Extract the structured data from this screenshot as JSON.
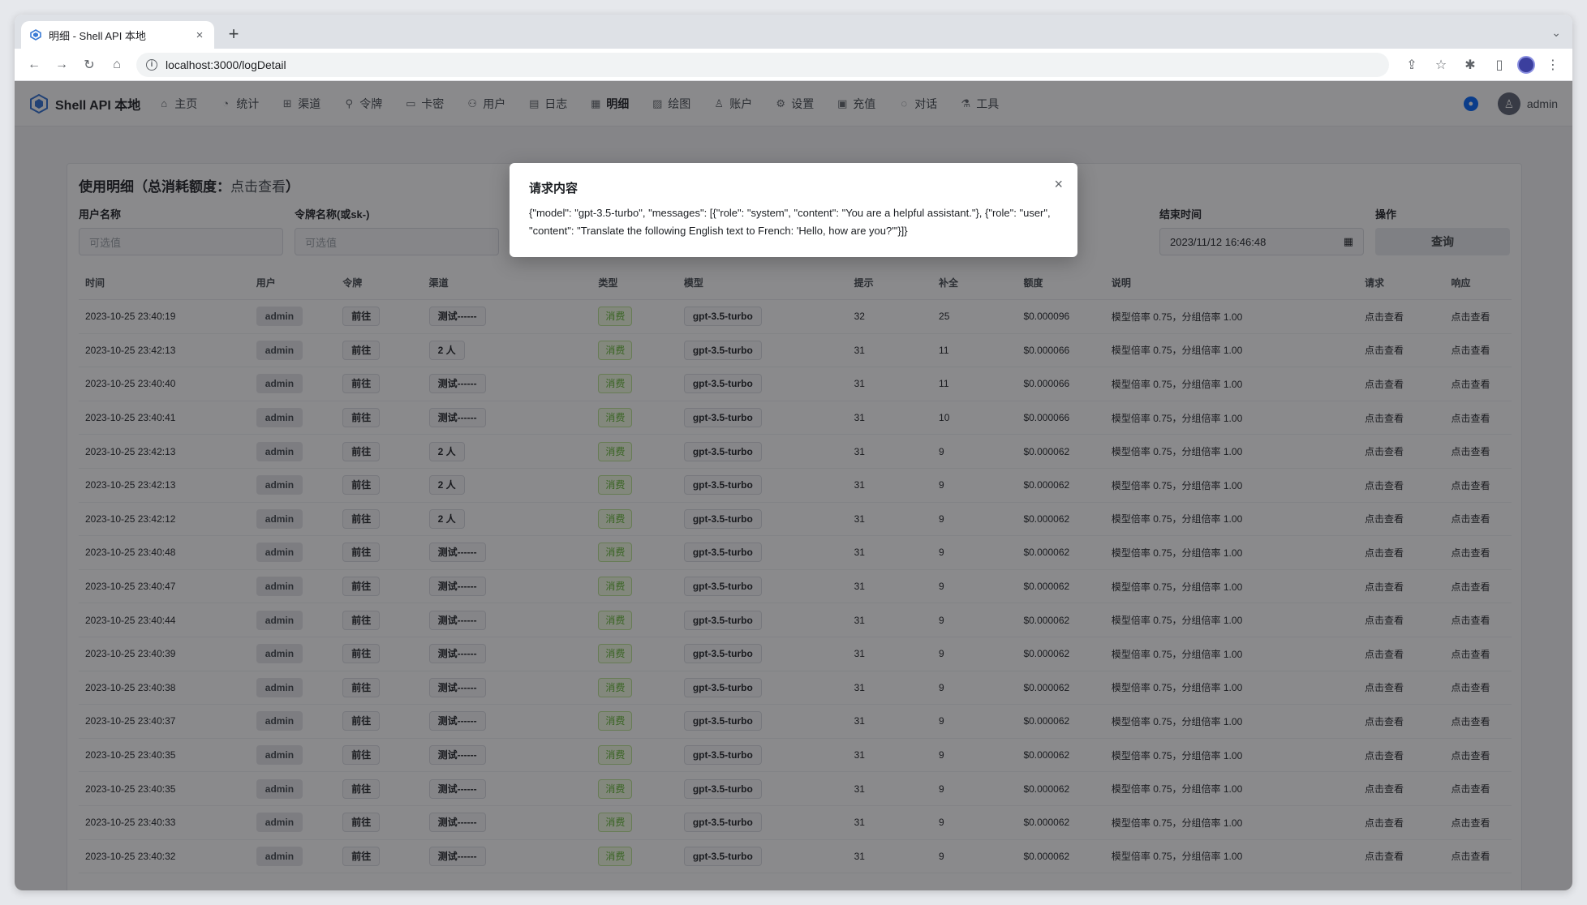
{
  "browser": {
    "tab_title": "明细 - Shell API 本地",
    "tab_close": "×",
    "new_tab": "+",
    "url": "localhost:3000/logDetail"
  },
  "navbar": {
    "brand": "Shell API 本地",
    "items": [
      {
        "label": "主页",
        "icon": "home-icon",
        "glyph": "⌂"
      },
      {
        "label": "统计",
        "icon": "chart-icon",
        "glyph": "◔"
      },
      {
        "label": "渠道",
        "icon": "channel-icon",
        "glyph": "⊞"
      },
      {
        "label": "令牌",
        "icon": "key-icon",
        "glyph": "⚲"
      },
      {
        "label": "卡密",
        "icon": "card-icon",
        "glyph": "▭"
      },
      {
        "label": "用户",
        "icon": "users-icon",
        "glyph": "⚇"
      },
      {
        "label": "日志",
        "icon": "log-icon",
        "glyph": "▤"
      },
      {
        "label": "明细",
        "icon": "detail-icon",
        "glyph": "▦"
      },
      {
        "label": "绘图",
        "icon": "image-icon",
        "glyph": "▨"
      },
      {
        "label": "账户",
        "icon": "account-icon",
        "glyph": "♙"
      },
      {
        "label": "设置",
        "icon": "settings-icon",
        "glyph": "⚙"
      },
      {
        "label": "充值",
        "icon": "recharge-icon",
        "glyph": "▣"
      },
      {
        "label": "对话",
        "icon": "chat-icon",
        "glyph": "◌"
      },
      {
        "label": "工具",
        "icon": "tool-icon",
        "glyph": "⚗"
      }
    ],
    "active": "明细",
    "user": "admin"
  },
  "card": {
    "title": "使用明细（总消耗额度：",
    "title_link": "点击查看",
    "title_end": "）"
  },
  "filters": {
    "username_label": "用户名称",
    "username_placeholder": "可选值",
    "token_label": "令牌名称(或sk-)",
    "token_placeholder": "可选值",
    "end_time_label": "结束时间",
    "end_time_value": "2023/11/12 16:46:48",
    "action_label": "操作",
    "query_button": "查询"
  },
  "table": {
    "headers": [
      "时间",
      "用户",
      "令牌",
      "渠道",
      "类型",
      "模型",
      "提示",
      "补全",
      "额度",
      "说明",
      "请求",
      "响应"
    ],
    "rows": [
      {
        "time": "2023-10-25 23:40:19",
        "user": "admin",
        "token": "前往",
        "channel": "测试------",
        "type": "消费",
        "model": "gpt-3.5-turbo",
        "prompt": "32",
        "completion": "25",
        "amount": "$0.000096",
        "desc": "模型倍率 0.75，分组倍率 1.00",
        "req": "点击查看",
        "resp": "点击查看"
      },
      {
        "time": "2023-10-25 23:42:13",
        "user": "admin",
        "token": "前往",
        "channel": "2 人",
        "type": "消费",
        "model": "gpt-3.5-turbo",
        "prompt": "31",
        "completion": "11",
        "amount": "$0.000066",
        "desc": "模型倍率 0.75，分组倍率 1.00",
        "req": "点击查看",
        "resp": "点击查看"
      },
      {
        "time": "2023-10-25 23:40:40",
        "user": "admin",
        "token": "前往",
        "channel": "测试------",
        "type": "消费",
        "model": "gpt-3.5-turbo",
        "prompt": "31",
        "completion": "11",
        "amount": "$0.000066",
        "desc": "模型倍率 0.75，分组倍率 1.00",
        "req": "点击查看",
        "resp": "点击查看"
      },
      {
        "time": "2023-10-25 23:40:41",
        "user": "admin",
        "token": "前往",
        "channel": "测试------",
        "type": "消费",
        "model": "gpt-3.5-turbo",
        "prompt": "31",
        "completion": "10",
        "amount": "$0.000066",
        "desc": "模型倍率 0.75，分组倍率 1.00",
        "req": "点击查看",
        "resp": "点击查看"
      },
      {
        "time": "2023-10-25 23:42:13",
        "user": "admin",
        "token": "前往",
        "channel": "2 人",
        "type": "消费",
        "model": "gpt-3.5-turbo",
        "prompt": "31",
        "completion": "9",
        "amount": "$0.000062",
        "desc": "模型倍率 0.75，分组倍率 1.00",
        "req": "点击查看",
        "resp": "点击查看"
      },
      {
        "time": "2023-10-25 23:42:13",
        "user": "admin",
        "token": "前往",
        "channel": "2 人",
        "type": "消费",
        "model": "gpt-3.5-turbo",
        "prompt": "31",
        "completion": "9",
        "amount": "$0.000062",
        "desc": "模型倍率 0.75，分组倍率 1.00",
        "req": "点击查看",
        "resp": "点击查看"
      },
      {
        "time": "2023-10-25 23:42:12",
        "user": "admin",
        "token": "前往",
        "channel": "2 人",
        "type": "消费",
        "model": "gpt-3.5-turbo",
        "prompt": "31",
        "completion": "9",
        "amount": "$0.000062",
        "desc": "模型倍率 0.75，分组倍率 1.00",
        "req": "点击查看",
        "resp": "点击查看"
      },
      {
        "time": "2023-10-25 23:40:48",
        "user": "admin",
        "token": "前往",
        "channel": "测试------",
        "type": "消费",
        "model": "gpt-3.5-turbo",
        "prompt": "31",
        "completion": "9",
        "amount": "$0.000062",
        "desc": "模型倍率 0.75，分组倍率 1.00",
        "req": "点击查看",
        "resp": "点击查看"
      },
      {
        "time": "2023-10-25 23:40:47",
        "user": "admin",
        "token": "前往",
        "channel": "测试------",
        "type": "消费",
        "model": "gpt-3.5-turbo",
        "prompt": "31",
        "completion": "9",
        "amount": "$0.000062",
        "desc": "模型倍率 0.75，分组倍率 1.00",
        "req": "点击查看",
        "resp": "点击查看"
      },
      {
        "time": "2023-10-25 23:40:44",
        "user": "admin",
        "token": "前往",
        "channel": "测试------",
        "type": "消费",
        "model": "gpt-3.5-turbo",
        "prompt": "31",
        "completion": "9",
        "amount": "$0.000062",
        "desc": "模型倍率 0.75，分组倍率 1.00",
        "req": "点击查看",
        "resp": "点击查看"
      },
      {
        "time": "2023-10-25 23:40:39",
        "user": "admin",
        "token": "前往",
        "channel": "测试------",
        "type": "消费",
        "model": "gpt-3.5-turbo",
        "prompt": "31",
        "completion": "9",
        "amount": "$0.000062",
        "desc": "模型倍率 0.75，分组倍率 1.00",
        "req": "点击查看",
        "resp": "点击查看"
      },
      {
        "time": "2023-10-25 23:40:38",
        "user": "admin",
        "token": "前往",
        "channel": "测试------",
        "type": "消费",
        "model": "gpt-3.5-turbo",
        "prompt": "31",
        "completion": "9",
        "amount": "$0.000062",
        "desc": "模型倍率 0.75，分组倍率 1.00",
        "req": "点击查看",
        "resp": "点击查看"
      },
      {
        "time": "2023-10-25 23:40:37",
        "user": "admin",
        "token": "前往",
        "channel": "测试------",
        "type": "消费",
        "model": "gpt-3.5-turbo",
        "prompt": "31",
        "completion": "9",
        "amount": "$0.000062",
        "desc": "模型倍率 0.75，分组倍率 1.00",
        "req": "点击查看",
        "resp": "点击查看"
      },
      {
        "time": "2023-10-25 23:40:35",
        "user": "admin",
        "token": "前往",
        "channel": "测试------",
        "type": "消费",
        "model": "gpt-3.5-turbo",
        "prompt": "31",
        "completion": "9",
        "amount": "$0.000062",
        "desc": "模型倍率 0.75，分组倍率 1.00",
        "req": "点击查看",
        "resp": "点击查看"
      },
      {
        "time": "2023-10-25 23:40:35",
        "user": "admin",
        "token": "前往",
        "channel": "测试------",
        "type": "消费",
        "model": "gpt-3.5-turbo",
        "prompt": "31",
        "completion": "9",
        "amount": "$0.000062",
        "desc": "模型倍率 0.75，分组倍率 1.00",
        "req": "点击查看",
        "resp": "点击查看"
      },
      {
        "time": "2023-10-25 23:40:33",
        "user": "admin",
        "token": "前往",
        "channel": "测试------",
        "type": "消费",
        "model": "gpt-3.5-turbo",
        "prompt": "31",
        "completion": "9",
        "amount": "$0.000062",
        "desc": "模型倍率 0.75，分组倍率 1.00",
        "req": "点击查看",
        "resp": "点击查看"
      },
      {
        "time": "2023-10-25 23:40:32",
        "user": "admin",
        "token": "前往",
        "channel": "测试------",
        "type": "消费",
        "model": "gpt-3.5-turbo",
        "prompt": "31",
        "completion": "9",
        "amount": "$0.000062",
        "desc": "模型倍率 0.75，分组倍率 1.00",
        "req": "点击查看",
        "resp": "点击查看"
      }
    ]
  },
  "modal": {
    "title": "请求内容",
    "body": "{\"model\": \"gpt-3.5-turbo\", \"messages\": [{\"role\": \"system\", \"content\": \"You are a helpful assistant.\"}, {\"role\": \"user\", \"content\": \"Translate the following English text to French: 'Hello, how are you?'\"}]}",
    "close": "×"
  },
  "colors": {
    "accent": "#0064fa",
    "type_tag_text": "#5cb32c",
    "overlay": "rgba(22,22,26,0.50)"
  }
}
